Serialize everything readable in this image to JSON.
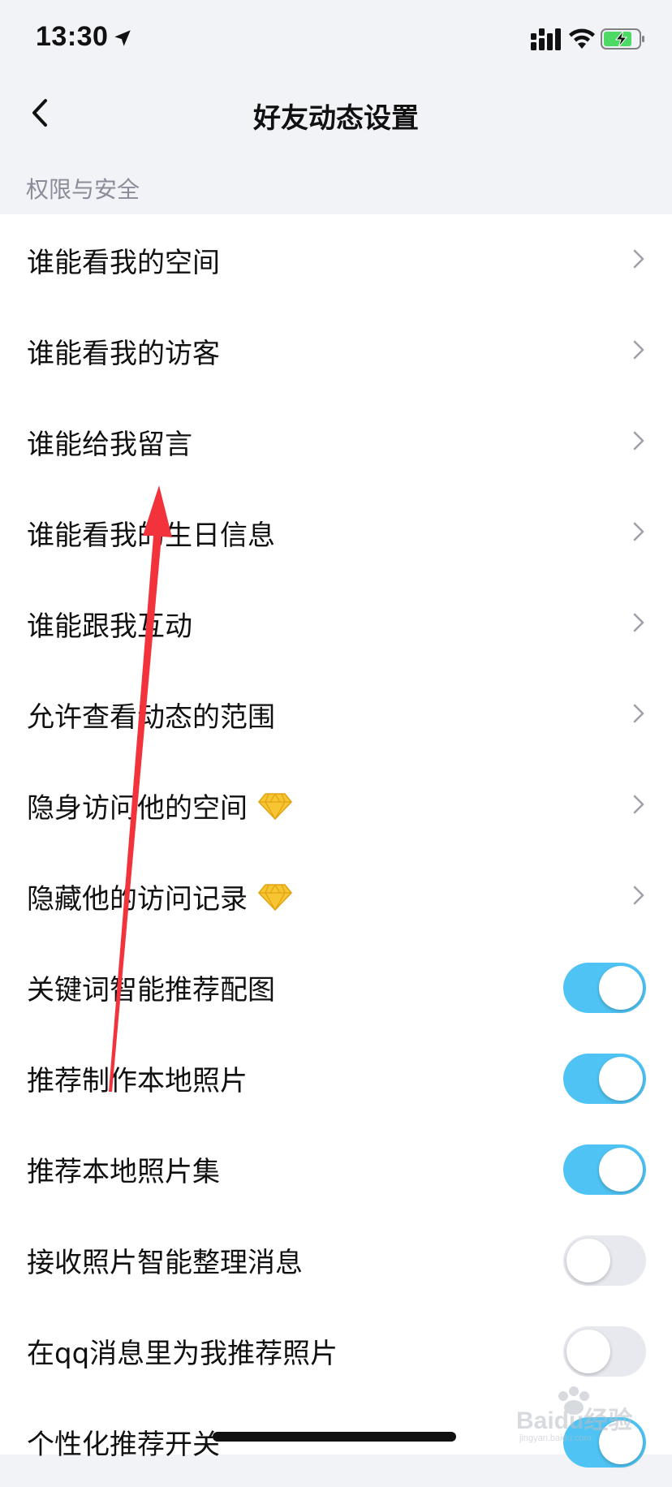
{
  "status": {
    "time": "13:30",
    "location_icon": "location-arrow-icon",
    "signal_icon": "cellular-signal-icon",
    "wifi_icon": "wifi-icon",
    "battery_icon": "battery-charging-icon",
    "battery_color": "#4cd964"
  },
  "nav": {
    "title": "好友动态设置",
    "back_icon": "chevron-left-icon"
  },
  "section": {
    "title": "权限与安全"
  },
  "rows": [
    {
      "label": "谁能看我的空间",
      "type": "link"
    },
    {
      "label": "谁能看我的访客",
      "type": "link"
    },
    {
      "label": "谁能给我留言",
      "type": "link"
    },
    {
      "label": "谁能看我的生日信息",
      "type": "link"
    },
    {
      "label": "谁能跟我互动",
      "type": "link"
    },
    {
      "label": "允许查看动态的范围",
      "type": "link"
    },
    {
      "label": "隐身访问他的空间",
      "type": "link",
      "vip": true
    },
    {
      "label": "隐藏他的访问记录",
      "type": "link",
      "vip": true
    },
    {
      "label": "关键词智能推荐配图",
      "type": "toggle",
      "on": true
    },
    {
      "label": "推荐制作本地照片",
      "type": "toggle",
      "on": true
    },
    {
      "label": "推荐本地照片集",
      "type": "toggle",
      "on": true
    },
    {
      "label": "接收照片智能整理消息",
      "type": "toggle",
      "on": false
    },
    {
      "label": "在qq消息里为我推荐照片",
      "type": "toggle",
      "on": false
    },
    {
      "label": "个性化推荐开关",
      "type": "toggle",
      "on": true
    }
  ],
  "colors": {
    "toggle_on": "#4fc4f4",
    "toggle_off": "#e7e9ef",
    "annotation_arrow": "#f2333c",
    "vip_gem": "#f7c531"
  },
  "watermark": {
    "text": "Baidu经验",
    "subtext": "jingyan.baidu.com"
  }
}
